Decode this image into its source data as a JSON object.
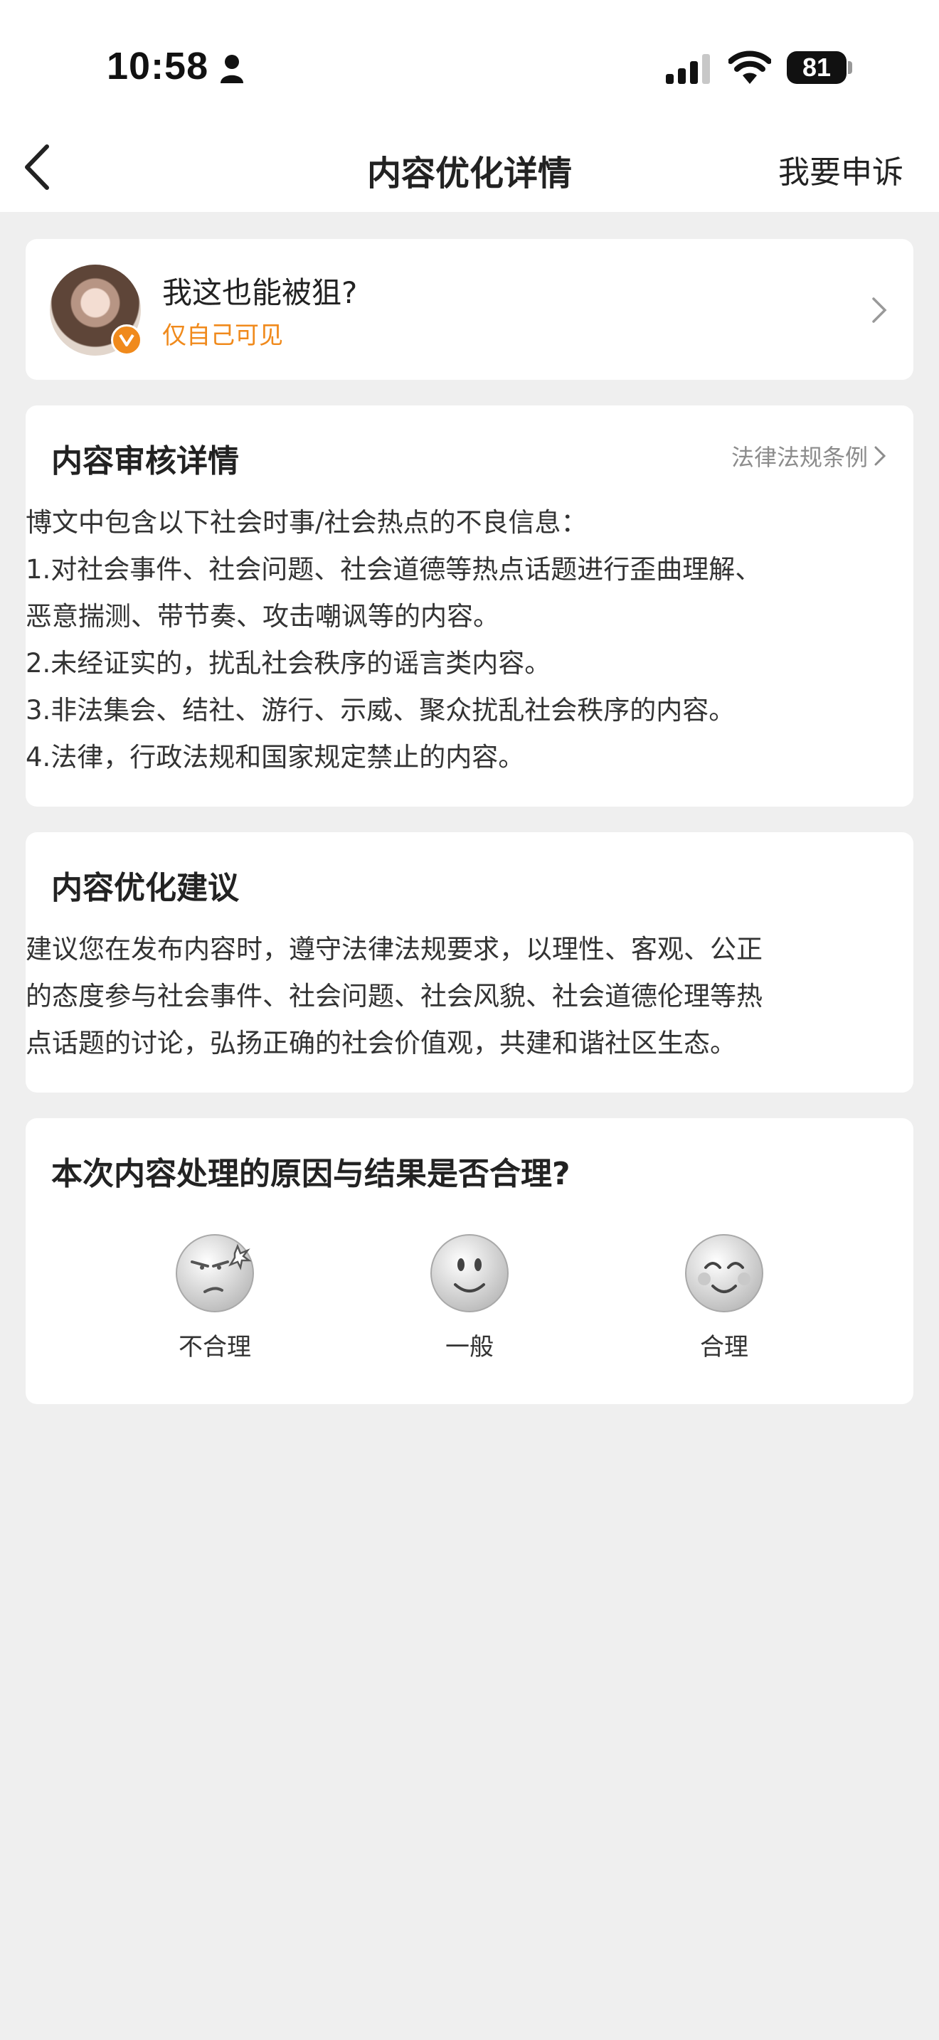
{
  "status_bar": {
    "time": "10:58",
    "battery": "81"
  },
  "nav": {
    "title": "内容优化详情",
    "appeal_label": "我要申诉"
  },
  "post": {
    "title": "我这也能被狙?",
    "visibility": "仅自己可见",
    "accent_color": "#f08a1c"
  },
  "review": {
    "heading": "内容审核详情",
    "law_link_label": "法律法规条例",
    "lines": [
      "博文中包含以下社会时事/社会热点的不良信息：",
      "1.对社会事件、社会问题、社会道德等热点话题进行歪曲理解、",
      "恶意揣测、带节奏、攻击嘲讽等的内容。",
      "2.未经证实的，扰乱社会秩序的谣言类内容。",
      "3.非法集会、结社、游行、示威、聚众扰乱社会秩序的内容。",
      "4.法律，行政法规和国家规定禁止的内容。"
    ]
  },
  "suggestion": {
    "heading": "内容优化建议",
    "lines": [
      "建议您在发布内容时，遵守法律法规要求，以理性、客观、公正",
      "的态度参与社会事件、社会问题、社会风貌、社会道德伦理等热",
      "点话题的讨论，弘扬正确的社会价值观，共建和谐社区生态。"
    ]
  },
  "feedback": {
    "question": "本次内容处理的原因与结果是否合理?",
    "options": [
      {
        "label": "不合理",
        "icon": "angry-face-icon"
      },
      {
        "label": "一般",
        "icon": "neutral-face-icon"
      },
      {
        "label": "合理",
        "icon": "happy-face-icon"
      }
    ]
  }
}
